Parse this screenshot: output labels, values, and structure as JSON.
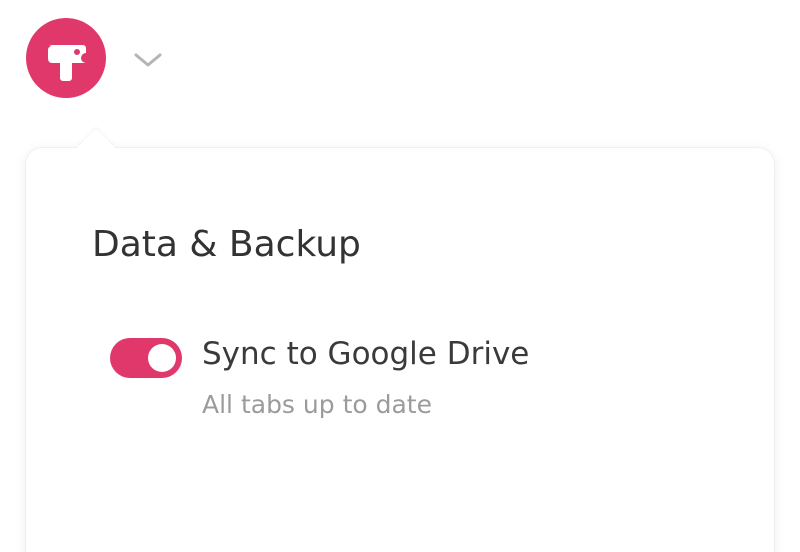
{
  "app": {
    "logo_icon": "ticket-icon",
    "menu_icon": "chevron-down-icon",
    "accent_color": "#e0386a"
  },
  "panel": {
    "title": "Data & Backup",
    "setting": {
      "label": "Sync to Google Drive",
      "status": "All tabs up to date",
      "enabled": true
    }
  }
}
